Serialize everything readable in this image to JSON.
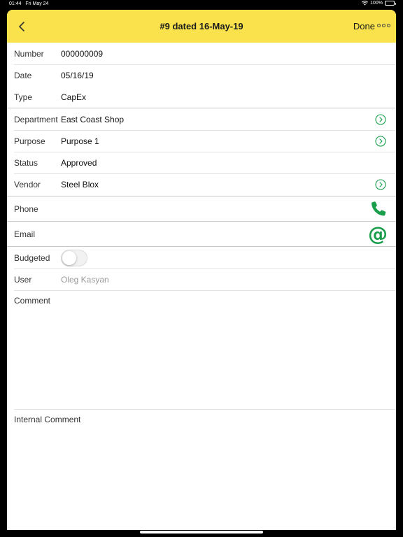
{
  "status_bar": {
    "time": "01:44",
    "date": "Fri May 24",
    "battery": "100%"
  },
  "navbar": {
    "title": "#9 dated 16-May-19",
    "done_label": "Done"
  },
  "fields": {
    "number": {
      "label": "Number",
      "value": "000000009"
    },
    "date": {
      "label": "Date",
      "value": "05/16/19"
    },
    "type": {
      "label": "Type",
      "value": "CapEx"
    },
    "department": {
      "label": "Department",
      "value": "East Coast Shop"
    },
    "purpose": {
      "label": "Purpose",
      "value": "Purpose 1"
    },
    "status": {
      "label": "Status",
      "value": "Approved"
    },
    "vendor": {
      "label": "Vendor",
      "value": "Steel Blox"
    },
    "phone": {
      "label": "Phone",
      "value": ""
    },
    "email": {
      "label": "Email",
      "value": ""
    },
    "budgeted": {
      "label": "Budgeted",
      "checked": false
    },
    "user": {
      "label": "User",
      "value": "Oleg Kasyan"
    },
    "comment": {
      "label": "Comment",
      "value": ""
    },
    "internal_comment": {
      "label": "Internal Comment",
      "value": ""
    }
  },
  "colors": {
    "header_bg": "#f9e24b",
    "accent_green": "#1a9e4b"
  },
  "icons": {
    "back": "chevron-left-icon",
    "more": "ellipsis-icon",
    "disclosure": "chevron-right-circle-icon",
    "phone": "phone-icon",
    "email": "at-sign-icon"
  }
}
